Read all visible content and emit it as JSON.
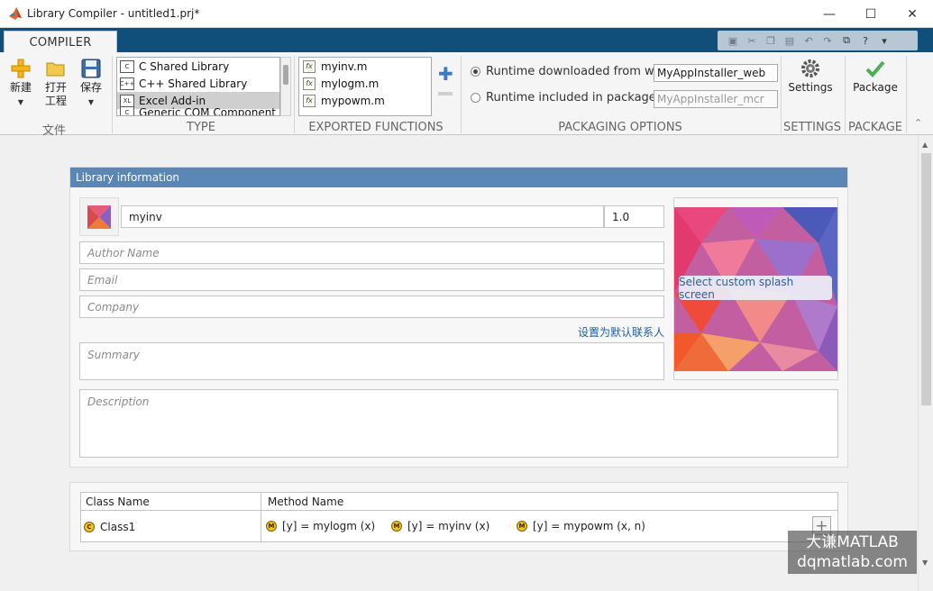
{
  "window": {
    "title": "Library Compiler - untitled1.prj*",
    "minimize": "—",
    "maximize": "☐",
    "close": "✕"
  },
  "tabs": [
    {
      "label": "COMPILER"
    }
  ],
  "ribbon": {
    "file_group": {
      "label": "文件",
      "new_label": "新建",
      "open_label_1": "打开",
      "open_label_2": "工程",
      "save_label": "保存"
    },
    "type_group": {
      "label": "TYPE",
      "items": [
        {
          "label": "C Shared Library",
          "selected": false
        },
        {
          "label": "C++ Shared Library",
          "selected": false
        },
        {
          "label": "Excel Add-in",
          "selected": true
        },
        {
          "label": "Generic COM Component",
          "selected": false
        }
      ]
    },
    "exported_functions": {
      "label": "EXPORTED FUNCTIONS",
      "items": [
        "myinv.m",
        "mylogm.m",
        "mypowm.m"
      ]
    },
    "packaging_options": {
      "label": "PACKAGING OPTIONS",
      "runtime_web_label": "Runtime downloaded from web",
      "runtime_web_value": "MyAppInstaller_web",
      "runtime_pkg_label": "Runtime included in package",
      "runtime_pkg_value": "MyAppInstaller_mcr"
    },
    "settings": {
      "label": "SETTINGS",
      "button": "Settings"
    },
    "package": {
      "label": "PACKAGE",
      "button": "Package"
    }
  },
  "library_info": {
    "header": "Library information",
    "name": "myinv",
    "version": "1.0",
    "author_placeholder": "Author Name",
    "email_placeholder": "Email",
    "company_placeholder": "Company",
    "set_default_contact": "设置为默认联系人",
    "summary_placeholder": "Summary",
    "description_placeholder": "Description",
    "splash_button": "Select custom splash screen"
  },
  "class_table": {
    "col_class": "Class Name",
    "col_method": "Method Name",
    "rows": [
      {
        "class_name": "Class1",
        "methods": [
          "[y] = mylogm (x)",
          "[y] = myinv (x)",
          "[y] = mypowm (x, n)"
        ]
      }
    ]
  },
  "watermark": {
    "line1": "大谦MATLAB",
    "line2": "dqmatlab.com"
  },
  "colors": {
    "ribbon_tab_strip": "#0f4f7a",
    "panel_header": "#5a87b5",
    "link": "#1f5fa0"
  }
}
